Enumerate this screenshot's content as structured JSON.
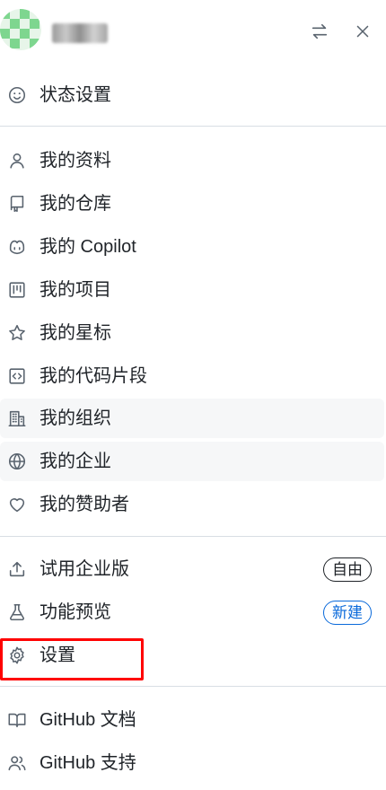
{
  "header": {
    "avatar_icon": "identicon-avatar",
    "switch_icon": "switch-account-icon",
    "close_icon": "close-icon"
  },
  "status": {
    "label": "状态设置",
    "icon": "smiley-icon"
  },
  "personal": [
    {
      "label": "我的资料",
      "icon": "person-icon"
    },
    {
      "label": "我的仓库",
      "icon": "repo-icon"
    },
    {
      "label": "我的 Copilot",
      "icon": "copilot-icon"
    },
    {
      "label": "我的项目",
      "icon": "project-icon"
    },
    {
      "label": "我的星标",
      "icon": "star-icon"
    },
    {
      "label": "我的代码片段",
      "icon": "code-square-icon"
    },
    {
      "label": "我的组织",
      "icon": "organization-icon"
    },
    {
      "label": "我的企业",
      "icon": "globe-icon"
    },
    {
      "label": "我的赞助者",
      "icon": "heart-icon"
    }
  ],
  "account": [
    {
      "label": "试用企业版",
      "icon": "upload-icon",
      "badge": "自由"
    },
    {
      "label": "功能预览",
      "icon": "beaker-icon",
      "badge": "新建"
    },
    {
      "label": "设置",
      "icon": "gear-icon"
    }
  ],
  "help": [
    {
      "label": "GitHub 文档",
      "icon": "book-icon"
    },
    {
      "label": "GitHub 支持",
      "icon": "people-icon"
    }
  ],
  "colors": {
    "text": "#1f2328",
    "icon": "#59636e",
    "accent": "#0969da",
    "highlight": "#ff0000",
    "hover_bg": "#f6f7f8"
  }
}
